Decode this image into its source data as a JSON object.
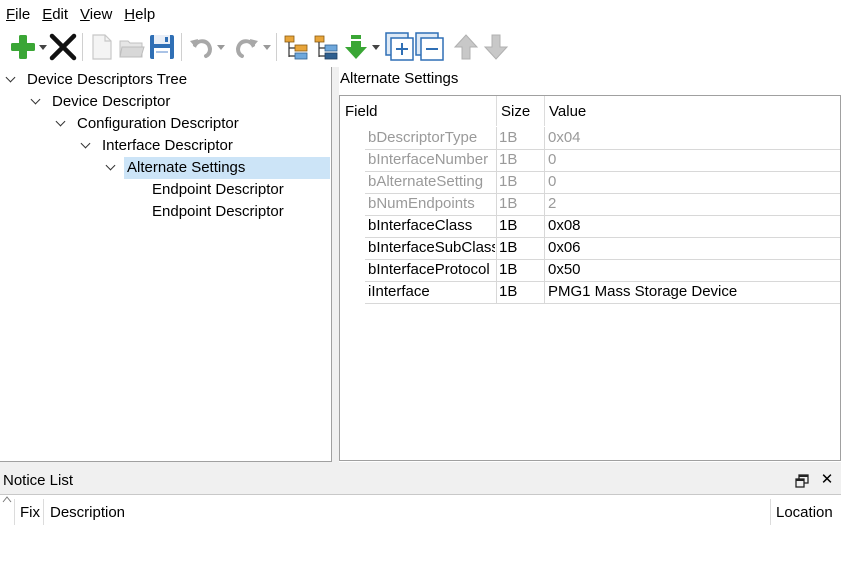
{
  "menu": {
    "items": [
      {
        "label": "File",
        "accel": "F",
        "rest": "ile"
      },
      {
        "label": "Edit",
        "accel": "E",
        "rest": "dit"
      },
      {
        "label": "View",
        "accel": "V",
        "rest": "iew"
      },
      {
        "label": "Help",
        "accel": "H",
        "rest": "elp"
      }
    ]
  },
  "toolbar": {
    "icons": [
      "add-icon",
      "delete-icon",
      "new-file-icon",
      "open-folder-icon",
      "save-icon",
      "undo-icon",
      "redo-icon",
      "tree-icon",
      "tree-alt-icon",
      "download-arrow-icon",
      "expand-icon",
      "collapse-icon",
      "move-up-icon",
      "move-down-icon"
    ]
  },
  "tree": {
    "items": [
      {
        "label": "Device Descriptors Tree",
        "depth": 0,
        "expanded": true
      },
      {
        "label": "Device Descriptor",
        "depth": 1,
        "expanded": true
      },
      {
        "label": "Configuration Descriptor",
        "depth": 2,
        "expanded": true
      },
      {
        "label": "Interface Descriptor",
        "depth": 3,
        "expanded": true
      },
      {
        "label": "Alternate Settings",
        "depth": 4,
        "expanded": true,
        "selected": true
      },
      {
        "label": "Endpoint Descriptor",
        "depth": 5
      },
      {
        "label": "Endpoint Descriptor",
        "depth": 5
      }
    ]
  },
  "detail": {
    "title": "Alternate Settings",
    "columns": {
      "field": "Field",
      "size": "Size",
      "value": "Value"
    },
    "rows": [
      {
        "field": "bDescriptorType",
        "size": "1B",
        "value": "0x04",
        "editable": false
      },
      {
        "field": "bInterfaceNumber",
        "size": "1B",
        "value": "0",
        "editable": false
      },
      {
        "field": "bAlternateSetting",
        "size": "1B",
        "value": "0",
        "editable": false
      },
      {
        "field": "bNumEndpoints",
        "size": "1B",
        "value": "2",
        "editable": false
      },
      {
        "field": "bInterfaceClass",
        "size": "1B",
        "value": "0x08",
        "editable": true
      },
      {
        "field": "bInterfaceSubClass",
        "size": "1B",
        "value": "0x06",
        "editable": true
      },
      {
        "field": "bInterfaceProtocol",
        "size": "1B",
        "value": "0x50",
        "editable": true
      },
      {
        "field": "iInterface",
        "size": "1B",
        "value": "PMG1 Mass Storage Device",
        "editable": true
      }
    ]
  },
  "notice": {
    "title": "Notice List",
    "columns": {
      "fix": "Fix",
      "description": "Description",
      "location": "Location"
    }
  },
  "colors": {
    "selection": "#cce4f7",
    "green": "#3aa635",
    "blue_icon": "#2f6fb5",
    "disabled": "#9a9a9a"
  }
}
